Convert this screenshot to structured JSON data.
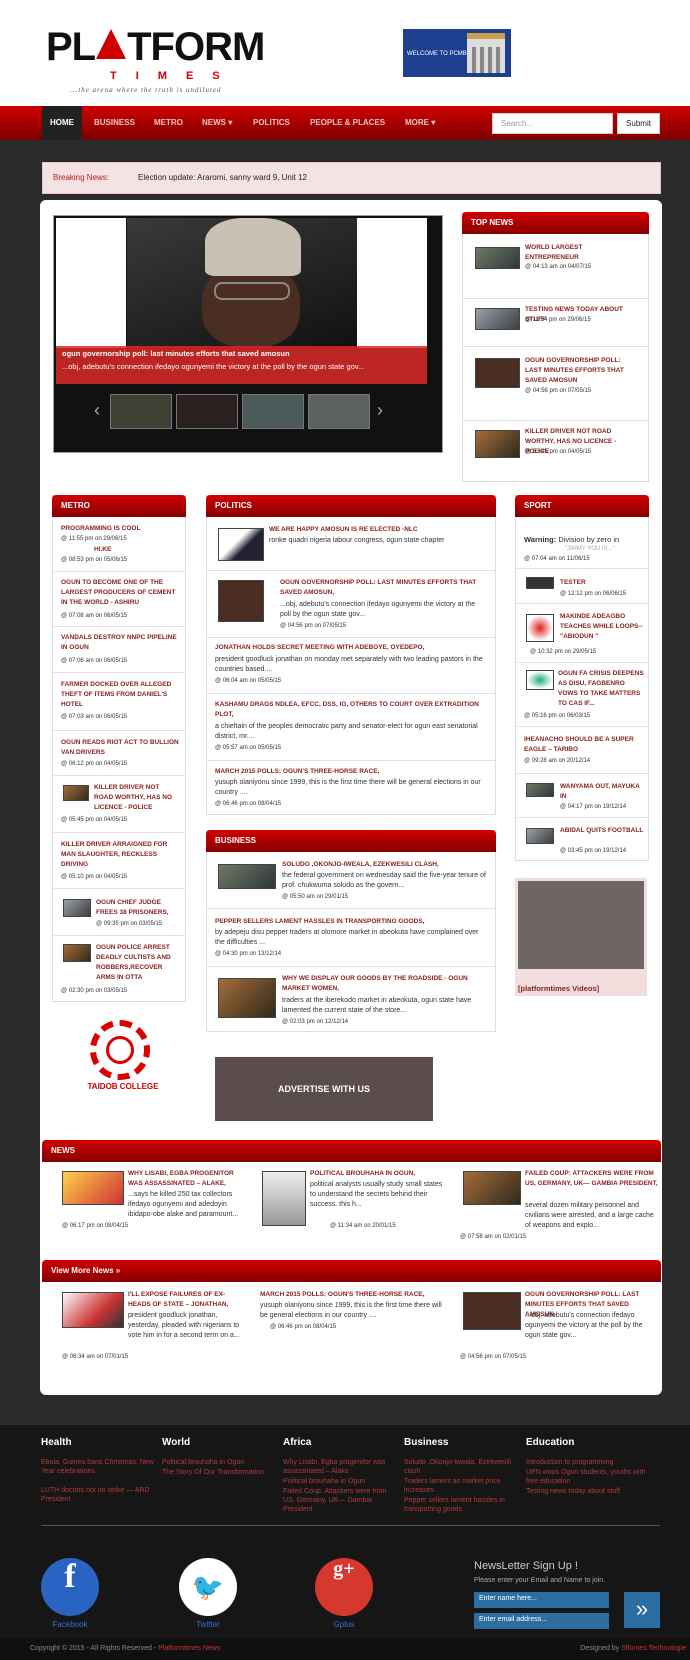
{
  "header": {
    "logo_word_left": "PL",
    "logo_word_right": "TFORM",
    "logo_times": "TIMES",
    "logo_tagline": "...the arena where the truth is undiluted",
    "welcome_banner": "WELCOME TO PCMB"
  },
  "nav": {
    "items": [
      "HOME",
      "BUSINESS",
      "METRO",
      "NEWS ▾",
      "POLITICS",
      "PEOPLE & PLACES",
      "MORE ▾"
    ],
    "search_placeholder": "Search...",
    "submit": "Submit"
  },
  "breaking": {
    "label": "Breaking News:",
    "text": "Election update: Araromi, sanny ward 9, Unit 12"
  },
  "slider": {
    "caption_title": "ogun governorship poll: last minutes efforts that saved amosun",
    "caption_desc": "...obj, adebutu's connection ifedayo ogunyemi the victory at the poll by the ogun state gov..."
  },
  "top_news": {
    "heading": "TOP NEWS",
    "items": [
      {
        "title": "WORLD LARGEST ENTREPRENEUR",
        "meta": "@ 04:13 am on 04/07/15"
      },
      {
        "title": "TESTING NEWS TODAY ABOUT STUFF",
        "meta": "@ 11:54 pm on 29/06/15"
      },
      {
        "title": "OGUN GOVERNORSHIP POLL: LAST MINUTES EFFORTS THAT SAVED AMOSUN",
        "meta": "@ 04:56 pm on 07/05/15"
      },
      {
        "title": "KILLER DRIVER NOT ROAD WORTHY, HAS NO LICENCE - POLICE",
        "meta": "@ 05:45 pm on 04/05/15"
      }
    ]
  },
  "metro": {
    "heading": "METRO",
    "items": [
      {
        "title": "PROGRAMMING IS COOL",
        "meta": "@ 11:55 pm on 29/06/15"
      },
      {
        "title": "HI.KE",
        "meta": "@ 08:53 pm on 05/06/15"
      },
      {
        "title": "OGUN TO BECOME ONE OF THE LARGEST PRODUCERS OF CEMENT IN THE WORLD - ASHIRU",
        "meta": "@ 07:08 am on 06/05/15"
      },
      {
        "title": "VANDALS DESTROY NNPC PIPELINE IN OGUN",
        "meta": "@ 07:06 am on 06/05/15"
      },
      {
        "title": "FARMER DOCKED OVER ALLEGED THEFT OF ITEMS FROM DANIEL'S HOTEL",
        "meta": "@ 07:03 am on 06/05/15"
      },
      {
        "title": "OGUN READS RIOT ACT TO BULLION VAN DRIVERS",
        "meta": "@ 06:12 pm on 04/05/15"
      },
      {
        "title": "KILLER DRIVER NOT ROAD WORTHY, HAS NO LICENCE - POLICE",
        "meta": "@ 05:45 pm on 04/05/15"
      },
      {
        "title": "KILLER DRIVER ARRAIGNED FOR MAN SLAUGHTER, RECKLESS DRIVING",
        "meta": "@ 05:10 pm on 04/05/15"
      },
      {
        "title": "OGUN CHIEF JUDGE FREES 38 PRISONERS,",
        "meta": "@ 09:35 pm on 03/05/15"
      },
      {
        "title": "OGUN POLICE ARREST DEADLY CULTISTS AND ROBBERS,RECOVER ARMS IN OTTA",
        "meta": "@ 02:30 pm on 03/05/15"
      }
    ]
  },
  "politics": {
    "heading": "POLITICS",
    "items": [
      {
        "title": "WE ARE HAPPY AMOSUN IS RE ELECTED -NLC",
        "desc": "ronke quadri nigeria labour congress, ogun state chapter",
        "meta": ""
      },
      {
        "title": "OGUN GOVERNORSHIP POLL: LAST MINUTES EFFORTS THAT SAVED AMOSUN,",
        "desc": "...obj, adebutu's connection ifedayo ogunyemi the victory at the poll by the ogun state gov...",
        "meta": "@ 04:56 pm on 07/05/15"
      },
      {
        "title": "JONATHAN HOLDS SECRET MEETING WITH ADEBOYE, OYEDEPO,",
        "desc": "president goodluck jonathan on monday met separately with two leading pastors in the countries based....",
        "meta": "@ 06:04 am on 05/05/15"
      },
      {
        "title": "KASHAMU DRAGS NDLEA, EFCC, DSS, IG, OTHERS TO COURT OVER EXTRADITION PLOT,",
        "desc": "a chieftain of the peoples democratic party and senator-elect for ogun east senatorial district, mr....",
        "meta": "@ 05:57 am on 05/05/15"
      },
      {
        "title": "MARCH 2015 POLLS: OGUN'S THREE-HORSE RACE,",
        "desc": "yusuph olaniyonu since 1999, this is the first time there will be general elections in our country ....",
        "meta": "@ 06:46 pm on 08/04/15"
      }
    ]
  },
  "business": {
    "heading": "BUSINESS",
    "items": [
      {
        "title": "SOLUDO ,OKONJO-IWEALA, EZEKWESILI CLASH,",
        "desc": "the federal government on wednesday said the five-year tenure of prof. chukwuma soludo as the govern...",
        "meta": "@ 05:50 am on 29/01/15"
      },
      {
        "title": "PEPPER SELLERS LAMENT HASSLES IN TRANSPORTING GOODS,",
        "desc": "by adepeju disu pepper traders at olomore market in abeokuta have complained over the difficulties ...",
        "meta": "@ 04:30 pm on 13/12/14"
      },
      {
        "title": "WHY WE DISPLAY OUR GOODS BY THE ROADSIDE - OGUN MARKET WOMEN,",
        "desc": "traders at the iberekodo market in abeokuta, ogun state have lamented the current state of the store...",
        "meta": "@ 02:03 pm on 12/12/14"
      }
    ]
  },
  "sport": {
    "heading": "SPORT",
    "warning_label": "Warning:",
    "warning_text": "Division by zero in",
    "warning_cut": "\"JIMMY YOU IS...\"",
    "items": [
      {
        "title": "",
        "meta": "@ 07:04 am on 11/06/15"
      },
      {
        "title": "TESTER",
        "meta": "@ 12:12 pm on 06/06/15"
      },
      {
        "title": "MAKINDE ADEAGBO TEACHES WHILE LOOPS-- \"ABIODUN \"",
        "meta": "@ 10:32 pm on 29/05/15"
      },
      {
        "title": "OGUN FA CRISIS DEEPENS AS DISU, FAGBENRO VOWS TO TAKE MATTERS TO CAS IF...",
        "meta": "@ 05:16 pm on 06/03/15"
      },
      {
        "title": "IHEANACHO SHOULD BE A SUPER EAGLE – TARIBO",
        "meta": "@ 09:28 am on 20/12/14"
      },
      {
        "title": "WANYAMA OUT, MAYUKA IN",
        "meta": "@ 04:17 pm on 19/12/14"
      },
      {
        "title": "ABIDAL QUITS FOOTBALL",
        "meta": "@ 03:45 pm on 19/12/14"
      }
    ],
    "videos_label": "[platformtimes Videos]"
  },
  "taidob": {
    "label": "TAIDOB COLLEGE"
  },
  "advert": {
    "label": "ADVERTISE WITH US"
  },
  "news": {
    "heading": "NEWS",
    "items": [
      {
        "title": "WHY LISABI, EGBA PROGENITOR WAS ASSASSINATED – ALAKE,",
        "desc": "...says he killed 250 tax collectors ifedayo ogunyemi and adedoyin ibidapo-obe alake and paramount...",
        "meta": "@ 06:17 pm on 08/04/15"
      },
      {
        "title": "POLITICAL BROUHAHA IN OGUN,",
        "desc": "political analysts usually study small states to understand the secrets behind their success. this h...",
        "meta": "@ 11:34 am on 20/01/15"
      },
      {
        "title": "FAILED COUP: ATTACKERS WERE FROM US, GERMANY, UK— GAMBIA PRESIDENT,",
        "desc": "several dozen military personnel and civilians were arrested, and a large cache of weapons and explo...",
        "meta": "@ 07:58 am on 02/01/15"
      }
    ]
  },
  "more_news": {
    "heading": "View More News »",
    "items": [
      {
        "title": "I'LL EXPOSE FAILURES OF EX-HEADS OF STATE – JONATHAN,",
        "desc": "president goodluck jonathan, yesterday, pleaded with nigerians to vote him in for a second term on a...",
        "meta": "@ 06:34 am on 07/01/15"
      },
      {
        "title": "MARCH 2015 POLLS: OGUN'S THREE-HORSE RACE,",
        "desc": "yusuph olaniyonu since 1999, this is the first time there will be general elections in our country ....",
        "meta": "@ 06:46 pm on 08/04/15"
      },
      {
        "title": "OGUN GOVERNORSHIP POLL: LAST MINUTES EFFORTS THAT SAVED AMOSUN,",
        "desc": "...obj, adebutu's connection ifedayo ogunyemi the victory at the poll by the ogun state gov...",
        "meta": "@ 04:56 pm on 07/05/15"
      }
    ]
  },
  "footer": {
    "columns": [
      {
        "heading": "Health",
        "links": [
          "Ebola: Guinea bans Christmas, New Year celebrations",
          "LUTH doctors not on strike — ARD President"
        ]
      },
      {
        "heading": "World",
        "links": [
          "Political brouhaha in Ogun",
          "The Story Of Our Transformation"
        ]
      },
      {
        "heading": "Africa",
        "links": [
          "Why Lisabi, Egba progenitor was assassinated – Alake",
          "Political brouhaha in Ogun",
          "Failed Coup: Attackers were from US, Germany, UK— Gambia President"
        ]
      },
      {
        "heading": "Business",
        "links": [
          "Soludo ,Okonjo-Iweala, Ezekwesili clash",
          "Traders lament as market price increases",
          "Pepper sellers lament hassles in transporting goods"
        ]
      },
      {
        "heading": "Education",
        "links": [
          "Introduction to programming",
          "UPN woos Ogun students, youths with free education",
          "Testing news today about stuff"
        ]
      }
    ],
    "social": [
      {
        "glyph": "f",
        "label": "Facebook",
        "color": "#2a64c3"
      },
      {
        "glyph": "🐦",
        "label": "Twitter",
        "color": "#ffffff"
      },
      {
        "glyph": "g+",
        "label": "Gplus",
        "color": "#d5382d"
      }
    ],
    "newsletter": {
      "heading": "NewsLetter Sign Up !",
      "sub": "Please enter your Email and Name to join.",
      "name_placeholder": "Enter name here...",
      "email_placeholder": "Enter email address..."
    },
    "copyright": "Copyright © 2015 - All Rights Reserved -",
    "copyright_brand": "Platformtimes News",
    "designed_by": "Designed by",
    "designer": "Sflornes Technologie"
  }
}
